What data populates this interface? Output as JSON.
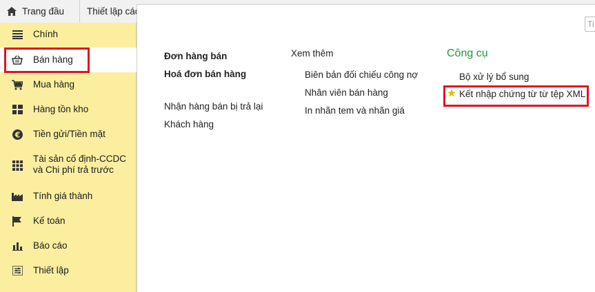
{
  "tabs": {
    "home_label": "Trang đầu",
    "settings_label": "Thiết lập các"
  },
  "sidebar": {
    "items": [
      {
        "label": "Chính",
        "icon": "menu-lines-icon"
      },
      {
        "label": "Bán hàng",
        "icon": "basket-icon"
      },
      {
        "label": "Mua hàng",
        "icon": "cart-icon"
      },
      {
        "label": "Hàng tồn kho",
        "icon": "warehouse-grid-icon"
      },
      {
        "label": "Tiền gửi/Tiền mặt",
        "icon": "euro-coin-icon"
      },
      {
        "label": "Tài sản cố định-CCDC",
        "label2": "và Chi phí trả trước",
        "icon": "grid-icon"
      },
      {
        "label": "Tính giá thành",
        "icon": "factory-icon"
      },
      {
        "label": "Kế toán",
        "icon": "flag-icon"
      },
      {
        "label": "Báo cáo",
        "icon": "bar-chart-icon"
      },
      {
        "label": "Thiết lập",
        "icon": "settings-sliders-icon"
      }
    ]
  },
  "main": {
    "col1": {
      "links": [
        "Đơn hàng bán",
        "Hoá đơn bán hàng",
        "Nhận hàng bán bị trả lại",
        "Khách hàng"
      ]
    },
    "col2": {
      "heading": "Xem thêm",
      "links": [
        "Biên bản đối chiếu công nợ",
        "Nhân viên bán hàng",
        "In nhãn tem và nhãn giá"
      ]
    },
    "col3": {
      "heading": "Công cụ",
      "links": [
        "Bộ xử lý bổ sung",
        "Kết nhập chứng từ từ tệp XML"
      ]
    },
    "search_placeholder": "Ti"
  },
  "colors": {
    "sidebar_bg": "#fbee9f",
    "highlight_border": "#e0141e",
    "tools_heading": "#1e9a3a",
    "star": "#f2b705"
  }
}
